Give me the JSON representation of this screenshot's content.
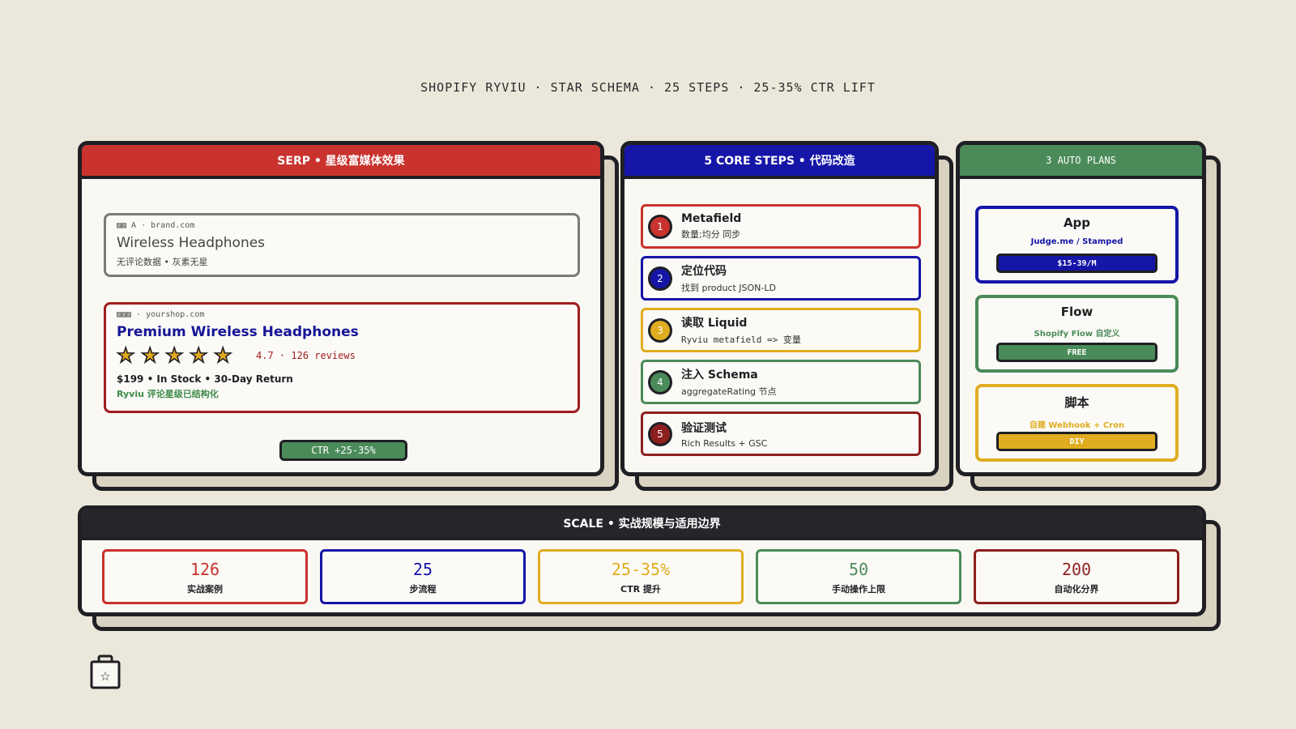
{
  "headline": "SHOPIFY RYVIU · STAR SCHEMA · 25 STEPS · 25-35% CTR LIFT",
  "colors": {
    "red": "#c9322d",
    "blue": "#1515a8",
    "green": "#4a8b59",
    "yellow": "#e0ad20",
    "darkred": "#8e1f1f",
    "dark": "#25252b",
    "background": "#ebe7da"
  },
  "serp": {
    "header": "SERP • 星级富媒体效果",
    "plain": {
      "url": "▨▨ A · brand.com",
      "title": "Wireless Headphones",
      "sub": "无评论数据 • 灰素无星"
    },
    "rich": {
      "url": "▨▨▨ · yourshop.com",
      "title": "Premium Wireless Headphones",
      "star_glyph": "★",
      "star_count": 5,
      "rating": "4.7 · 126 reviews",
      "price": "$199 • In Stock • 30-Day Return",
      "structured": "Ryviu 评论星级已结构化"
    },
    "ctr_badge": "CTR +25-35%"
  },
  "steps": {
    "header": "5 CORE STEPS • 代码改造",
    "items": [
      {
        "num": "1",
        "title": "Metafield",
        "sub": "数量;均分 同步",
        "color": "#c9322d"
      },
      {
        "num": "2",
        "title": "定位代码",
        "sub": "找到 product JSON-LD",
        "color": "#1515a8"
      },
      {
        "num": "3",
        "title": "读取 Liquid",
        "sub": "Ryviu metafield => 变量",
        "color": "#e0ad20"
      },
      {
        "num": "4",
        "title": "注入 Schema",
        "sub": "aggregateRating 节点",
        "color": "#4a8b59"
      },
      {
        "num": "5",
        "title": "验证测试",
        "sub": "Rich Results + GSC",
        "color": "#8e1f1f"
      }
    ]
  },
  "plans": {
    "header": "3 AUTO PLANS",
    "items": [
      {
        "name": "App",
        "desc": "Judge.me / Stamped",
        "price": "$15-39/M",
        "color": "#1515a8"
      },
      {
        "name": "Flow",
        "desc": "Shopify Flow 自定义",
        "price": "FREE",
        "color": "#4a8b59"
      },
      {
        "name": "脚本",
        "desc": "自建 Webhook + Cron",
        "price": "DIY",
        "color": "#e0ad20"
      }
    ]
  },
  "scale": {
    "header": "SCALE • 实战规模与适用边界",
    "items": [
      {
        "value": "126",
        "label": "实战案例",
        "color": "#c9322d"
      },
      {
        "value": "25",
        "label": "步流程",
        "color": "#1515a8"
      },
      {
        "value": "25-35%",
        "label": "CTR 提升",
        "color": "#e0ad20"
      },
      {
        "value": "50",
        "label": "手动操作上限",
        "color": "#4a8b59"
      },
      {
        "value": "200",
        "label": "自动化分界",
        "color": "#8e1f1f"
      }
    ]
  },
  "footer_icon": "shopping-bag-star-icon"
}
